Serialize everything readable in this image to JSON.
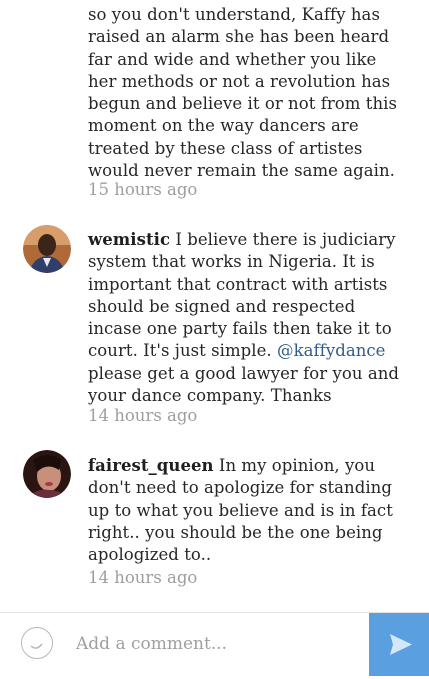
{
  "comments": [
    {
      "username": "",
      "line1": "so you don't understand, Kaffy has",
      "line2": "raised an alarm she has been heard",
      "line3": "far and wide and whether you like",
      "line4": "her methods or not a revolution has",
      "line5": "begun and believe it or not from this",
      "line6": "moment on the way dancers are",
      "line7": "treated by these class of  artistes",
      "line8": "would never remain the same again.",
      "time": "15 hours ago"
    },
    {
      "username": "wemistic",
      "text_a": " I believe there is judiciary system that works in Nigeria. It is important that contract with artists should be signed and respected incase one party fails then take it to court. It's just simple. ",
      "mention": "@kaffydance",
      "text_b": " please get a good lawyer for you and your dance company. Thanks",
      "time": "14 hours ago"
    },
    {
      "username": "fairest_queen",
      "text": " In my opinion, you don't need to apologize for standing up to what you believe and is in fact right.. you should be the one being apologized to..",
      "time": "14 hours ago"
    }
  ],
  "composer": {
    "placeholder": "Add a comment...",
    "emoji_icon": "smiley-icon",
    "send_icon": "send-arrow-icon"
  },
  "colors": {
    "accent": "#5aa0e0",
    "mention": "#2d5d8b",
    "timestamp": "#9e9e9e"
  }
}
